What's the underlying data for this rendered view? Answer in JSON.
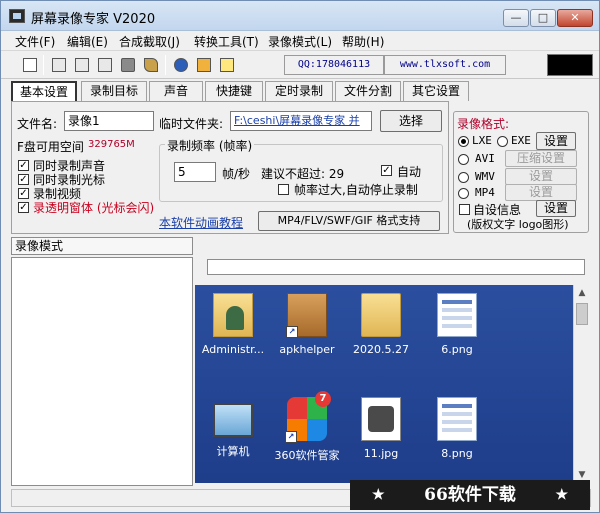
{
  "window": {
    "title": "屏幕录像专家 V2020",
    "min_glyph": "—",
    "max_glyph": "□",
    "close_glyph": "✕"
  },
  "menu": [
    "文件(F)",
    "编辑(E)",
    "合成截取(J)",
    "转换工具(T)",
    "录像模式(L)",
    "帮助(H)"
  ],
  "toolbar": {
    "qq": "QQ:178046113",
    "website": "www.tlxsoft.com"
  },
  "tabs": [
    "基本设置",
    "录制目标",
    "声音",
    "快捷键",
    "定时录制",
    "文件分割",
    "其它设置"
  ],
  "basic": {
    "filename_label": "文件名:",
    "filename_value": "录像1",
    "tempfolder_label": "临时文件夹:",
    "tempfolder_value": "F:\\ceshi\\屏幕录像专家 并",
    "browse_button": "选择",
    "disk_label": "F盘可用空间",
    "disk_value": "329765M",
    "options": [
      {
        "label": "同时录制声音",
        "checked": true
      },
      {
        "label": "同时录制光标",
        "checked": true
      },
      {
        "label": "录制视频",
        "checked": true
      },
      {
        "label": "录透明窗体 (光标会闪)",
        "checked": true
      }
    ],
    "framerate_group": "录制频率 (帧率)",
    "framerate_value": "5",
    "framerate_unit": "帧/秒",
    "suggest_text": "建议不超过: 29",
    "auto_label": "自动",
    "auto_checked": true,
    "stop_label": "帧率过大,自动停止录制",
    "stop_checked": false,
    "tutorial_link": "本软件动画教程",
    "format_support_button": "MP4/FLV/SWF/GIF  格式支持"
  },
  "format": {
    "title": "录像格式:",
    "options": [
      {
        "label": "LXE",
        "selected": true
      },
      {
        "label": "EXE",
        "selected": false
      },
      {
        "label": "AVI",
        "selected": false
      },
      {
        "label": "WMV",
        "selected": false
      },
      {
        "label": "MP4",
        "selected": false
      }
    ],
    "settings_button": "设置",
    "compress_button": "压缩设置",
    "wmv_settings": "设置",
    "mp4_settings": "设置",
    "custom_info_label": "自设信息",
    "custom_info_checked": false,
    "custom_info_button": "设置",
    "custom_info_note": "(版权文字 logo图形)"
  },
  "mode_tab": "录像模式",
  "desktop": {
    "icons": [
      {
        "label": "Administr...",
        "art": "user-folder"
      },
      {
        "label": "apkhelper",
        "art": "box"
      },
      {
        "label": "2020.5.27",
        "art": "folder"
      },
      {
        "label": "6.png",
        "art": "png"
      },
      {
        "label": "计算机",
        "art": "computer"
      },
      {
        "label": "360软件管家",
        "art": "360",
        "badge": "7"
      },
      {
        "label": "11.jpg",
        "art": "jpg"
      },
      {
        "label": "8.png",
        "art": "png"
      }
    ]
  },
  "watermark": {
    "text": "66软件下载",
    "star": "★"
  },
  "colors": {
    "title_bar": "#c2d6ee",
    "desktop": "#1e3d8a",
    "link": "#1a3fa8",
    "disk_value": "#b0002a",
    "format_title": "#b0002a"
  }
}
